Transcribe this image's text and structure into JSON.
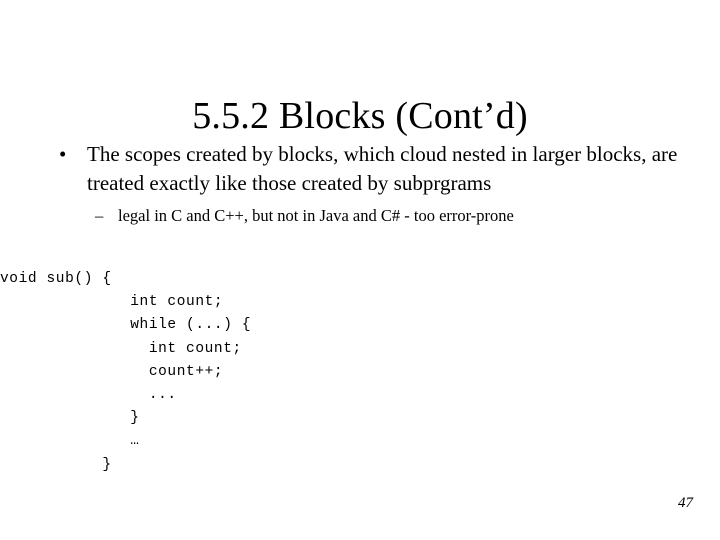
{
  "slide": {
    "title": "5.5.2 Blocks (Cont’d)",
    "page_number": "47",
    "background_color": "#ffffff",
    "text_color": "#000000"
  },
  "bullets": {
    "level1_marker": "•",
    "level2_marker": "–",
    "level1": [
      {
        "text": "The scopes created by blocks, which cloud nested in larger blocks, are treated exactly like those created by subprgrams"
      }
    ],
    "level2": [
      {
        "text": "legal in C and C++, but not in Java and C# - too error-prone"
      }
    ]
  },
  "code": {
    "lines": [
      "void sub() {",
      "              int count;",
      "              while (...) {",
      "                int count;",
      "                count++;",
      "                ...",
      "              }",
      "              …",
      "           }"
    ]
  }
}
